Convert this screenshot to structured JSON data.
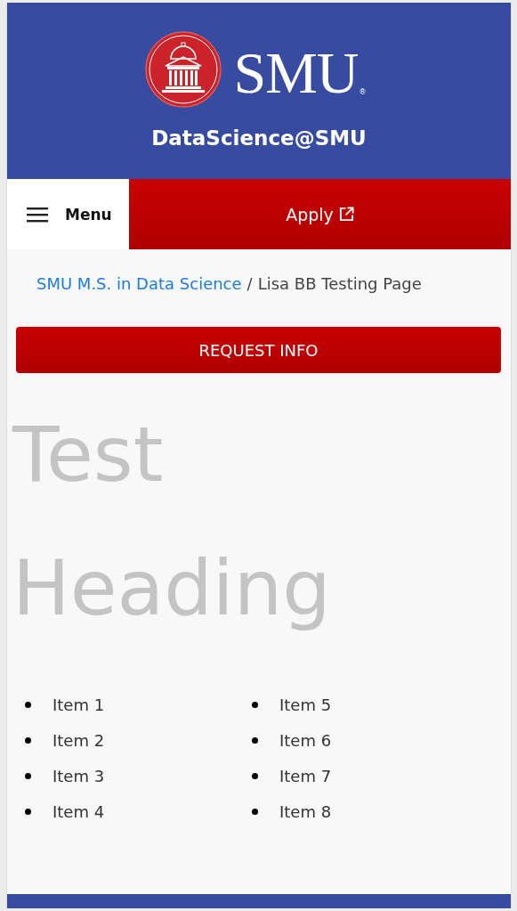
{
  "header": {
    "logo_text": "SMU",
    "logo_mark": "®",
    "site_name": "DataScience@SMU"
  },
  "nav": {
    "menu_label": "Menu",
    "apply_label": "Apply"
  },
  "breadcrumb": {
    "link": "SMU M.S. in Data Science",
    "separator": "/",
    "current": "Lisa BB Testing Page"
  },
  "request_button": "REQUEST INFO",
  "heading": "Test Heading",
  "lists": [
    [
      "Item 1",
      "Item 2",
      "Item 3",
      "Item 4"
    ],
    [
      "Item 5",
      "Item 6",
      "Item 7",
      "Item 8"
    ]
  ]
}
